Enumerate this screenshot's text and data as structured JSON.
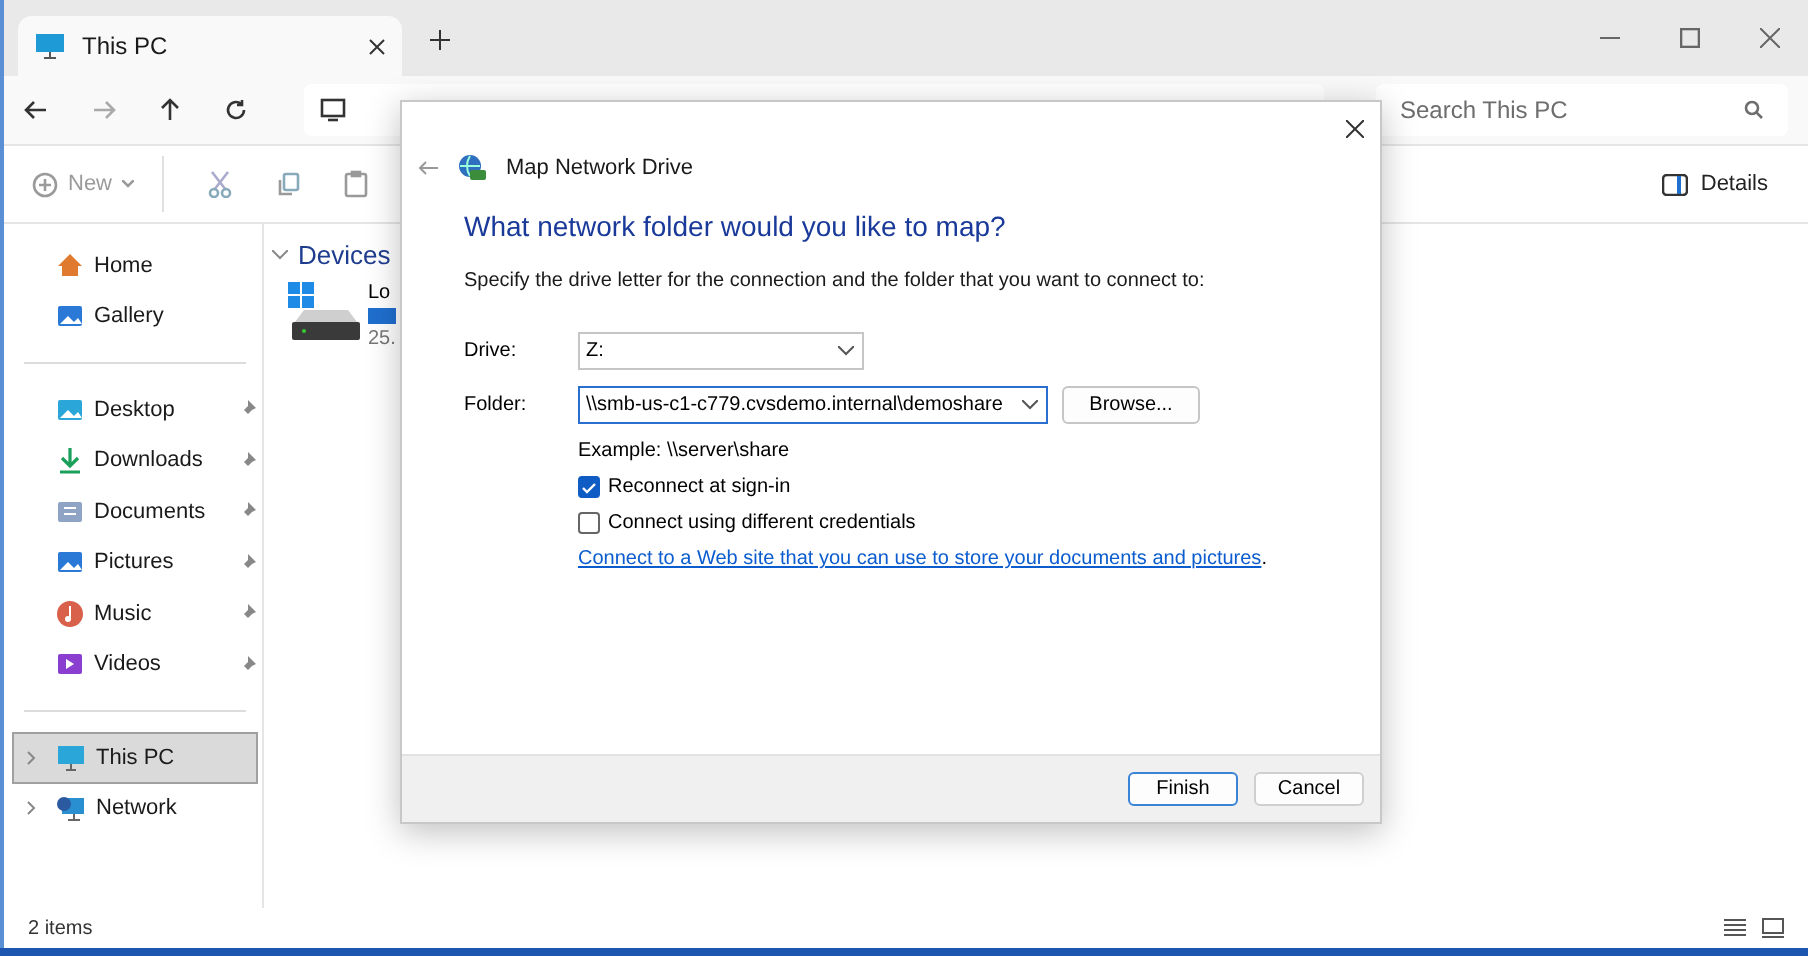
{
  "tabs": [
    {
      "title": "This PC",
      "selected": true
    }
  ],
  "search": {
    "placeholder": "Search This PC"
  },
  "toolbar": {
    "new_label": "New",
    "details_label": "Details"
  },
  "sidebar": {
    "groups": [
      [
        {
          "label": "Home",
          "kind": "home",
          "pinned": false,
          "selected": false
        },
        {
          "label": "Gallery",
          "kind": "gallery",
          "pinned": false,
          "selected": false
        }
      ],
      [
        {
          "label": "Desktop",
          "kind": "desktop",
          "pinned": true,
          "selected": false
        },
        {
          "label": "Downloads",
          "kind": "downloads",
          "pinned": true,
          "selected": false
        },
        {
          "label": "Documents",
          "kind": "documents",
          "pinned": true,
          "selected": false
        },
        {
          "label": "Pictures",
          "kind": "pictures",
          "pinned": true,
          "selected": false
        },
        {
          "label": "Music",
          "kind": "music",
          "pinned": true,
          "selected": false
        },
        {
          "label": "Videos",
          "kind": "videos",
          "pinned": true,
          "selected": false
        }
      ],
      [
        {
          "label": "This PC",
          "kind": "pc",
          "pinned": false,
          "selected": true,
          "expandable": true
        },
        {
          "label": "Network",
          "kind": "network",
          "pinned": false,
          "selected": false,
          "expandable": true
        }
      ]
    ]
  },
  "content": {
    "section": "Devices",
    "drive": {
      "name": "Lo",
      "size": "25."
    }
  },
  "status_bar": {
    "count": "2 items"
  },
  "dialog": {
    "title": "Map Network Drive",
    "heading": "What network folder would you like to map?",
    "instruction": "Specify the drive letter for the connection and the folder that you want to connect to:",
    "drive_label": "Drive:",
    "drive_value": "Z:",
    "folder_label": "Folder:",
    "folder_value": "\\\\smb-us-c1-c779.cvsdemo.internal\\demoshare",
    "browse": "Browse...",
    "example": "Example: \\\\server\\share",
    "options": [
      {
        "label": "Reconnect at sign-in",
        "checked": true
      },
      {
        "label": "Connect using different credentials",
        "checked": false
      }
    ],
    "link": "Connect to a Web site that you can use to store your documents and pictures",
    "link_suffix": ".",
    "buttons": [
      {
        "label": "Finish",
        "default": true
      },
      {
        "label": "Cancel",
        "default": false
      }
    ]
  }
}
